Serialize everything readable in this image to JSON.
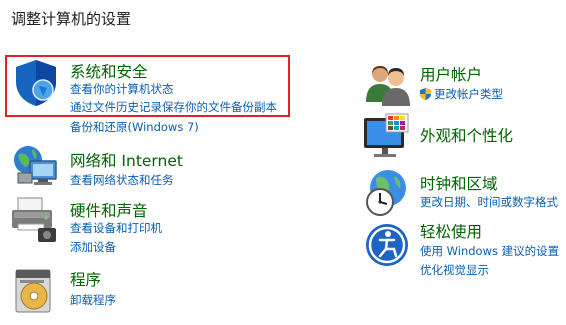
{
  "page_title": "调整计算机的设置",
  "left": [
    {
      "title": "系统和安全",
      "icon": "security-shield-icon",
      "links": [
        "查看你的计算机状态",
        "通过文件历史记录保存你的文件备份副本",
        "备份和还原(Windows 7)"
      ]
    },
    {
      "title": "网络和 Internet",
      "icon": "network-globe-icon",
      "links": [
        "查看网络状态和任务"
      ]
    },
    {
      "title": "硬件和声音",
      "icon": "printer-icon",
      "links": [
        "查看设备和打印机",
        "添加设备"
      ]
    },
    {
      "title": "程序",
      "icon": "programs-disc-icon",
      "links": [
        "卸载程序"
      ]
    }
  ],
  "right": [
    {
      "title": "用户帐户",
      "icon": "users-icon",
      "links": [
        "更改帐户类型"
      ]
    },
    {
      "title": "外观和个性化",
      "icon": "monitor-colors-icon",
      "links": []
    },
    {
      "title": "时钟和区域",
      "icon": "clock-globe-icon",
      "links": [
        "更改日期、时间或数字格式"
      ]
    },
    {
      "title": "轻松使用",
      "icon": "accessibility-icon",
      "links": [
        "使用 Windows 建议的设置",
        "优化视觉显示"
      ]
    }
  ],
  "colors": {
    "title_green": "#006400",
    "link_blue": "#0a5fb4",
    "highlight_red": "#e0202a"
  }
}
